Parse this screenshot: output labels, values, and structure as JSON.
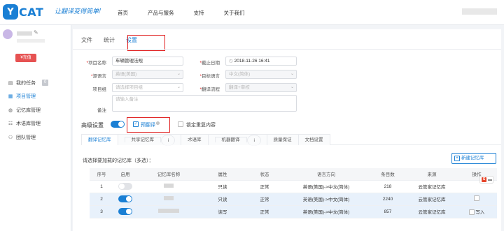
{
  "brand": {
    "logo_letter": "Y",
    "logo_text": "CAT",
    "slogan": "让翻译变得简单!"
  },
  "nav": [
    "首页",
    "产品与服务",
    "支持",
    "关于我们"
  ],
  "sidebar": {
    "edit_icon": "✎",
    "recharge_label": "充值",
    "menu": [
      {
        "label": "我的任务",
        "icon": "task-icon",
        "glyph": "▤",
        "badge": "0"
      },
      {
        "label": "项目管理",
        "icon": "project-icon",
        "glyph": "▦",
        "active": true
      },
      {
        "label": "记忆库管理",
        "icon": "memory-icon",
        "glyph": "◍"
      },
      {
        "label": "术语库管理",
        "icon": "term-icon",
        "glyph": "☷"
      },
      {
        "label": "团队管理",
        "icon": "team-icon",
        "glyph": "⚇"
      }
    ]
  },
  "tabs": [
    "文件",
    "统计",
    "设置"
  ],
  "active_tab": "设置",
  "form": {
    "project_name_label": "项目名称",
    "project_name_value": "车辆管理法规",
    "deadline_label": "截止日期",
    "deadline_value": "2018-11-26 16:41",
    "source_lang_label": "源语言",
    "source_lang_value": "英语(美国)",
    "target_lang_label": "目标语言",
    "target_lang_value": "中文(简体)",
    "project_group_label": "项目组",
    "project_group_placeholder": "请选择项目组",
    "workflow_label": "翻译流程",
    "workflow_value": "翻译+审校",
    "note_label": "备注",
    "note_placeholder": "请输入备注"
  },
  "advanced": {
    "label": "高级设置",
    "toggle_on": true,
    "pretranslate_label": "预翻译",
    "pretranslate_checked": true,
    "lock_repeat_label": "锁定重复内容",
    "lock_repeat_checked": false
  },
  "inner_tabs": [
    "翻译记忆库",
    "共享记忆库",
    "术语库",
    "机器翻译",
    "质量保证",
    "文档设置"
  ],
  "inner_tabs_info": [
    false,
    true,
    false,
    true,
    false,
    false
  ],
  "memory": {
    "select_hint": "请选择要加载的记忆库（多选）：",
    "new_button": "新建记忆库",
    "columns": [
      "序号",
      "启用",
      "记忆库名称",
      "属性",
      "状态",
      "语言方向",
      "条目数",
      "来源",
      "操作"
    ],
    "rows": [
      {
        "index": "1",
        "enabled": false,
        "attr": "只读",
        "status": "正常",
        "direction": "英语(美国)->中文(简体)",
        "count": "218",
        "source": "云管家记忆库"
      },
      {
        "index": "2",
        "enabled": true,
        "attr": "只读",
        "status": "正常",
        "direction": "英语(美国)->中文(简体)",
        "count": "2240",
        "source": "云管家记忆库"
      },
      {
        "index": "3",
        "enabled": true,
        "attr": "读写",
        "status": "正常",
        "direction": "英语(美国)->中文(简体)",
        "count": "857",
        "source": "云管家记忆库",
        "write_label": "写入"
      }
    ]
  },
  "colors": {
    "accent": "#1a7fd4",
    "highlight": "#e02020",
    "recharge": "#e65252"
  }
}
